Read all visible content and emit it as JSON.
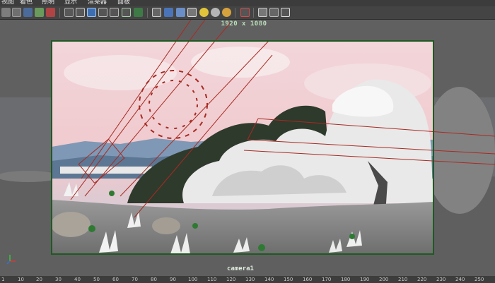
{
  "menu": [
    "视图",
    "着色",
    "照明",
    "显示",
    "渲染器",
    "面板"
  ],
  "viewport": {
    "resolution_gate_label": "1920 x 1080",
    "camera_label": "camera1"
  },
  "toolbar_icons": [
    "camera-attributes-icon",
    "bookmark-icon",
    "image-plane-icon",
    "2d-pan-zoom-icon",
    "grease-pencil-icon",
    "grid-icon",
    "film-gate-icon",
    "resolution-gate-icon",
    "gate-mask-icon",
    "field-chart-icon",
    "safe-action-icon",
    "safe-title-icon",
    "wireframe-icon",
    "smooth-shade-icon",
    "use-default-material-icon",
    "shaded-wireframe-icon",
    "textured-icon",
    "use-all-lights-icon",
    "shadows-icon",
    "screen-space-ambient-occlusion-icon",
    "isolate-select-icon",
    "xray-icon",
    "xray-active-components-icon",
    "xray-joints-icon"
  ],
  "time_ruler": {
    "ticks": [
      "1",
      "10",
      "20",
      "30",
      "40",
      "50",
      "60",
      "70",
      "80",
      "90",
      "100",
      "110",
      "120",
      "130",
      "140",
      "150",
      "160",
      "170",
      "180",
      "190",
      "200",
      "210",
      "220",
      "230",
      "240",
      "250"
    ]
  },
  "colors": {
    "resolution_gate": "#1e5a22",
    "camera_frustum": "#a82a22",
    "label_green": "#b9dfb9"
  }
}
